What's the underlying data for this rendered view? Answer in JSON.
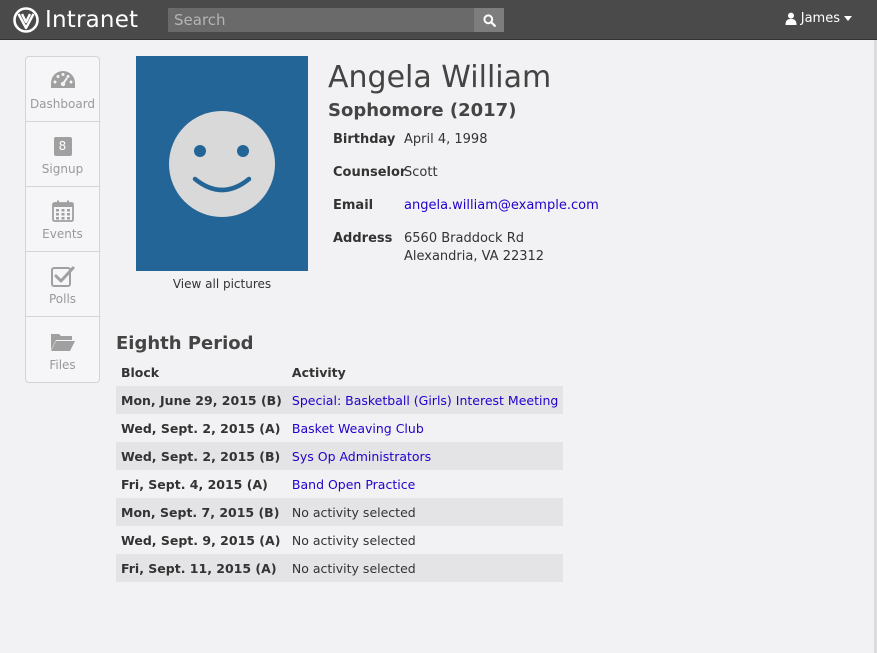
{
  "header": {
    "app_title": "Intranet",
    "search_placeholder": "Search",
    "user_name": "James"
  },
  "nav": {
    "items": [
      {
        "label": "Dashboard",
        "icon": "dashboard-icon"
      },
      {
        "label": "Signup",
        "icon": "calendar-number-icon",
        "badge": "8"
      },
      {
        "label": "Events",
        "icon": "calendar-icon"
      },
      {
        "label": "Polls",
        "icon": "checkbox-icon"
      },
      {
        "label": "Files",
        "icon": "folder-icon"
      }
    ]
  },
  "profile": {
    "name": "Angela William",
    "grade": "Sophomore (2017)",
    "view_pictures": "View all pictures",
    "fields": {
      "birthday_label": "Birthday",
      "birthday": "April 4, 1998",
      "counselor_label": "Counselor",
      "counselor": "Scott",
      "email_label": "Email",
      "email": "angela.william@example.com",
      "address_label": "Address",
      "address_line1": "6560 Braddock Rd",
      "address_line2": "Alexandria, VA 22312"
    }
  },
  "eighth": {
    "title": "Eighth Period",
    "columns": [
      "Block",
      "Activity"
    ],
    "rows": [
      {
        "block": "Mon, June 29, 2015 (B)",
        "activity": "Special: Basketball (Girls) Interest Meeting",
        "link": true
      },
      {
        "block": "Wed, Sept. 2, 2015 (A)",
        "activity": "Basket Weaving Club",
        "link": true
      },
      {
        "block": "Wed, Sept. 2, 2015 (B)",
        "activity": "Sys Op Administrators",
        "link": true
      },
      {
        "block": "Fri, Sept. 4, 2015 (A)",
        "activity": "Band Open Practice",
        "link": true
      },
      {
        "block": "Mon, Sept. 7, 2015 (B)",
        "activity": "No activity selected",
        "link": false
      },
      {
        "block": "Wed, Sept. 9, 2015 (A)",
        "activity": "No activity selected",
        "link": false
      },
      {
        "block": "Fri, Sept. 11, 2015 (A)",
        "activity": "No activity selected",
        "link": false
      }
    ]
  },
  "colors": {
    "header_bg": "#4a4a4a",
    "photo_bg": "#246597",
    "link": "#2200cc"
  }
}
